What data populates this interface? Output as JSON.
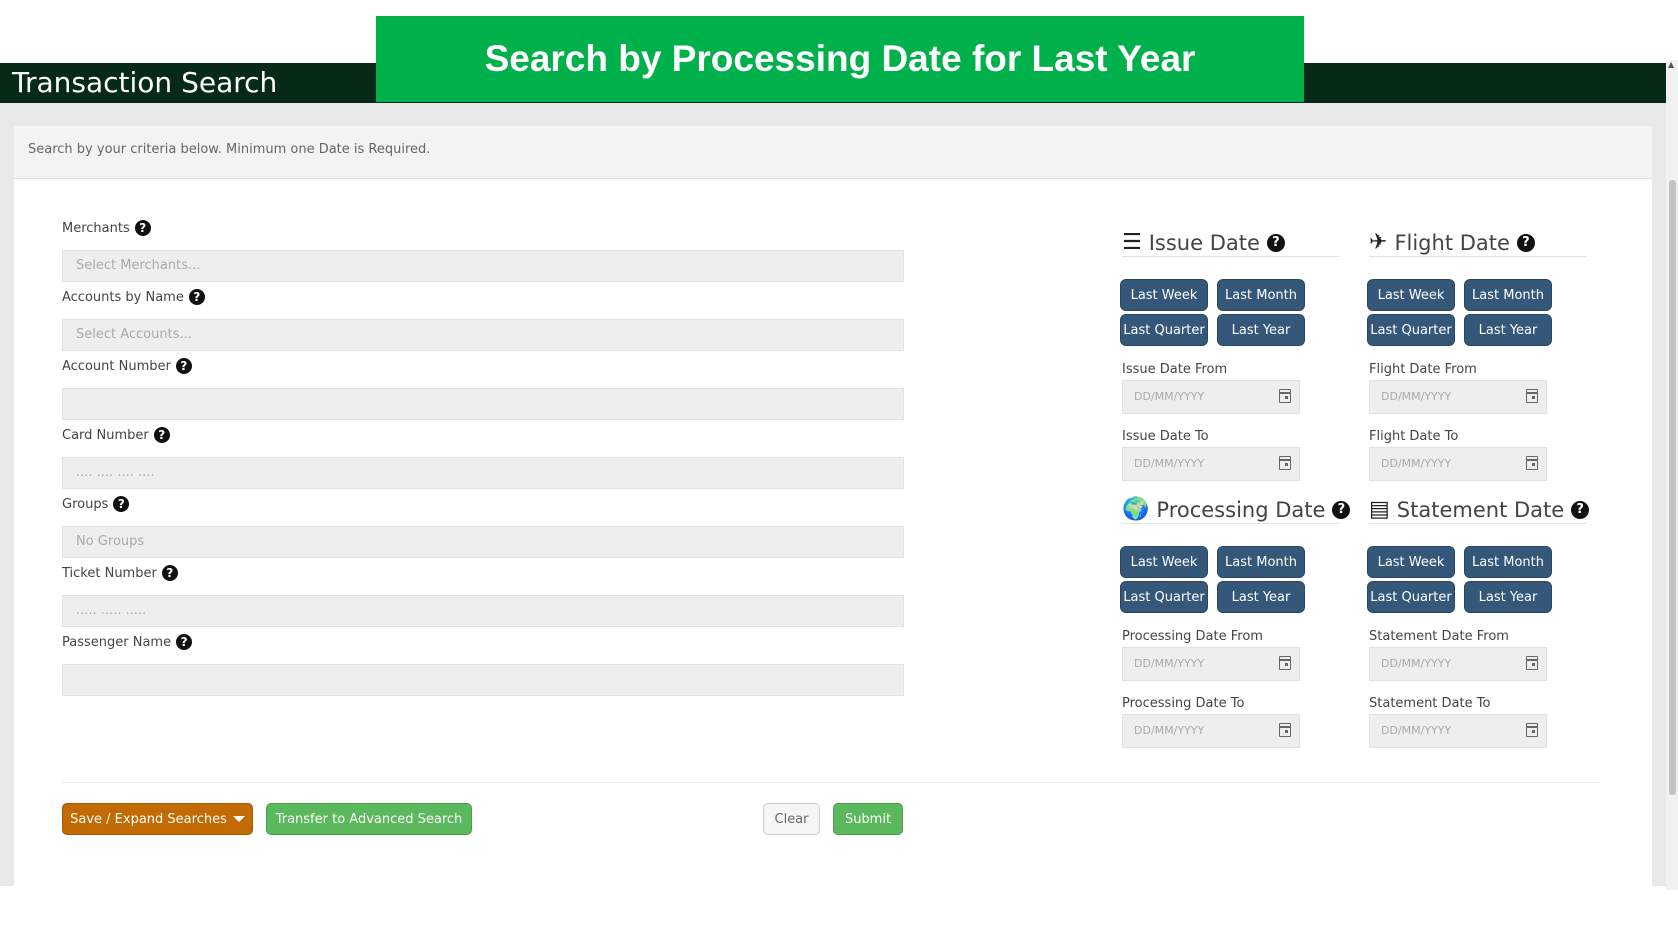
{
  "banner": {
    "text": "Search by Processing Date for Last Year"
  },
  "app": {
    "title": "Transaction Search"
  },
  "panel": {
    "hint": "Search by your criteria below. Minimum one Date is Required."
  },
  "fields": [
    {
      "label": "Merchants",
      "placeholder": "Select Merchants..."
    },
    {
      "label": "Accounts by Name",
      "placeholder": "Select Accounts..."
    },
    {
      "label": "Account Number",
      "placeholder": ""
    },
    {
      "label": "Card Number",
      "placeholder": ".... .... .... ...."
    },
    {
      "label": "Groups",
      "placeholder": "No Groups"
    },
    {
      "label": "Ticket Number",
      "placeholder": "..... ..... ....."
    },
    {
      "label": "Passenger Name",
      "placeholder": ""
    }
  ],
  "help_icon": "question-circle-icon",
  "quick_buttons": {
    "week": "Last Week",
    "month": "Last Month",
    "quarter": "Last Quarter",
    "year": "Last Year"
  },
  "date_placeholder": "DD/MM/YYYY",
  "date_groups": {
    "issue": {
      "title": "Issue Date",
      "icon": "list-icon",
      "from": "Issue Date From",
      "to": "Issue Date To"
    },
    "flight": {
      "title": "Flight Date",
      "icon": "plane-icon",
      "from": "Flight Date From",
      "to": "Flight Date To"
    },
    "processing": {
      "title": "Processing Date",
      "icon": "globe-icon",
      "from": "Processing Date From",
      "to": "Processing Date To"
    },
    "statement": {
      "title": "Statement Date",
      "icon": "list-alt-icon",
      "from": "Statement Date From",
      "to": "Statement Date To"
    }
  },
  "actions": {
    "save_expand": "Save / Expand Searches",
    "transfer": "Transfer to Advanced Search",
    "clear": "Clear",
    "submit": "Submit"
  },
  "colors": {
    "header": "#062a16",
    "banner": "#00b04b",
    "quick_button": "#35577a",
    "orange_button": "#c26a04",
    "green_button": "#5cb85c"
  }
}
